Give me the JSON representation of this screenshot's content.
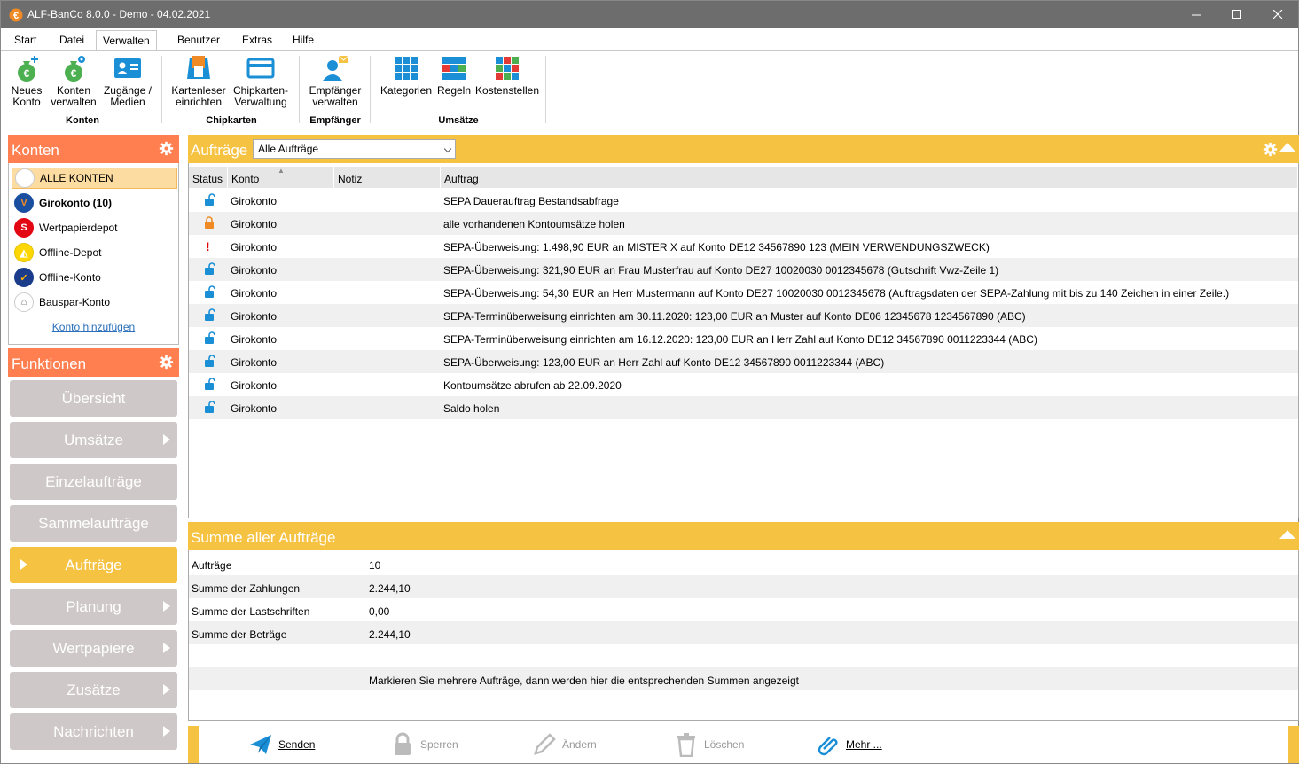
{
  "window": {
    "title": "ALF-BanCo 8.0.0 - Demo  -  04.02.2021"
  },
  "menu": {
    "tabs": [
      "Start",
      "Datei",
      "Verwalten",
      "Benutzer",
      "Extras",
      "Hilfe"
    ],
    "active": "Verwalten"
  },
  "ribbon": {
    "groups": [
      {
        "label": "Konten",
        "buttons": [
          {
            "line1": "Neues",
            "line2": "Konto"
          },
          {
            "line1": "Konten",
            "line2": "verwalten"
          },
          {
            "line1": "Zugänge /",
            "line2": "Medien"
          }
        ]
      },
      {
        "label": "Chipkarten",
        "buttons": [
          {
            "line1": "Kartenleser",
            "line2": "einrichten"
          },
          {
            "line1": "Chipkarten-",
            "line2": "Verwaltung"
          }
        ]
      },
      {
        "label": "Empfänger",
        "buttons": [
          {
            "line1": "Empfänger",
            "line2": "verwalten"
          }
        ]
      },
      {
        "label": "Umsätze",
        "buttons": [
          {
            "line1": "Kategorien",
            "line2": ""
          },
          {
            "line1": "Regeln",
            "line2": ""
          },
          {
            "line1": "Kostenstellen",
            "line2": ""
          }
        ]
      }
    ]
  },
  "konten": {
    "title": "Konten",
    "items": [
      {
        "label": "ALLE KONTEN",
        "icon": "all-accounts-icon",
        "selected": true
      },
      {
        "label": "Girokonto (10)",
        "icon": "volksbank-icon",
        "bold": true
      },
      {
        "label": "Wertpapierdepot",
        "icon": "sparkasse-icon"
      },
      {
        "label": "Offline-Depot",
        "icon": "commerzbank-icon"
      },
      {
        "label": "Offline-Konto",
        "icon": "bank-logo-icon"
      },
      {
        "label": "Bauspar-Konto",
        "icon": "building-icon"
      }
    ],
    "add_link": "Konto hinzufügen"
  },
  "funktionen": {
    "title": "Funktionen",
    "items": [
      {
        "label": "Übersicht",
        "arrow": false
      },
      {
        "label": "Umsätze",
        "arrow": true
      },
      {
        "label": "Einzelaufträge",
        "arrow": false
      },
      {
        "label": "Sammelaufträge",
        "arrow": false
      },
      {
        "label": "Aufträge",
        "arrow": false,
        "active": true
      },
      {
        "label": "Planung",
        "arrow": true
      },
      {
        "label": "Wertpapiere",
        "arrow": true
      },
      {
        "label": "Zusätze",
        "arrow": true
      },
      {
        "label": "Nachrichten",
        "arrow": true
      }
    ]
  },
  "orders": {
    "title": "Aufträge",
    "filter": "Alle Aufträge",
    "columns": [
      "Status",
      "Konto",
      "Notiz",
      "Auftrag"
    ],
    "rows": [
      {
        "status": "unlocked",
        "konto": "Girokonto",
        "notiz": "",
        "auftrag": "SEPA Dauerauftrag Bestandsabfrage"
      },
      {
        "status": "locked",
        "konto": "Girokonto",
        "notiz": "",
        "auftrag": "alle vorhandenen Kontoumsätze holen"
      },
      {
        "status": "error",
        "konto": "Girokonto",
        "notiz": "",
        "auftrag": "SEPA-Überweisung: 1.498,90 EUR an MISTER X auf Konto DE12 34567890 123 (MEIN VERWENDUNGSZWECK)"
      },
      {
        "status": "unlocked",
        "konto": "Girokonto",
        "notiz": "",
        "auftrag": "SEPA-Überweisung: 321,90 EUR an Frau Musterfrau auf Konto DE27 10020030 0012345678 (Gutschrift Vwz-Zeile 1)"
      },
      {
        "status": "unlocked",
        "konto": "Girokonto",
        "notiz": "",
        "auftrag": "SEPA-Überweisung: 54,30 EUR an Herr Mustermann auf Konto DE27 10020030 0012345678 (Auftragsdaten der SEPA-Zahlung mit bis zu 140 Zeichen in einer Zeile.)"
      },
      {
        "status": "unlocked",
        "konto": "Girokonto",
        "notiz": "",
        "auftrag": "SEPA-Terminüberweisung einrichten am 30.11.2020: 123,00 EUR an Muster auf Konto DE06 12345678 1234567890 (ABC)"
      },
      {
        "status": "unlocked",
        "konto": "Girokonto",
        "notiz": "",
        "auftrag": "SEPA-Terminüberweisung einrichten am 16.12.2020: 123,00 EUR an Herr Zahl auf Konto DE12 34567890 0011223344 (ABC)"
      },
      {
        "status": "unlocked",
        "konto": "Girokonto",
        "notiz": "",
        "auftrag": "SEPA-Überweisung: 123,00 EUR an Herr Zahl auf Konto DE12 34567890 0011223344 (ABC)"
      },
      {
        "status": "unlocked",
        "konto": "Girokonto",
        "notiz": "",
        "auftrag": "Kontoumsätze abrufen ab 22.09.2020"
      },
      {
        "status": "unlocked",
        "konto": "Girokonto",
        "notiz": "",
        "auftrag": "Saldo holen"
      }
    ]
  },
  "summary": {
    "title": "Summe aller Aufträge",
    "rows": [
      {
        "label": "Aufträge",
        "value": "10"
      },
      {
        "label": "Summe der Zahlungen",
        "value": "2.244,10"
      },
      {
        "label": "Summe der Lastschriften",
        "value": "0,00"
      },
      {
        "label": "Summe der Beträge",
        "value": "2.244,10"
      },
      {
        "label": "",
        "value": ""
      },
      {
        "label": "",
        "value": "Markieren Sie mehrere Aufträge, dann werden hier die entsprechenden Summen angezeigt"
      }
    ]
  },
  "actions": [
    {
      "label": "Senden",
      "icon": "send-icon",
      "enabled": true
    },
    {
      "label": "Sperren",
      "icon": "lock-icon",
      "enabled": false
    },
    {
      "label": "Ändern",
      "icon": "pencil-icon",
      "enabled": false
    },
    {
      "label": "Löschen",
      "icon": "trash-icon",
      "enabled": false
    },
    {
      "label": "Mehr ...",
      "icon": "paperclip-icon",
      "enabled": true
    }
  ],
  "colors": {
    "orange": "#ff7f50",
    "yellow": "#f5c242",
    "gray_button": "#cfc8c8",
    "lock_blue": "#1a8fd6",
    "titlebar": "#6d6d6d"
  }
}
